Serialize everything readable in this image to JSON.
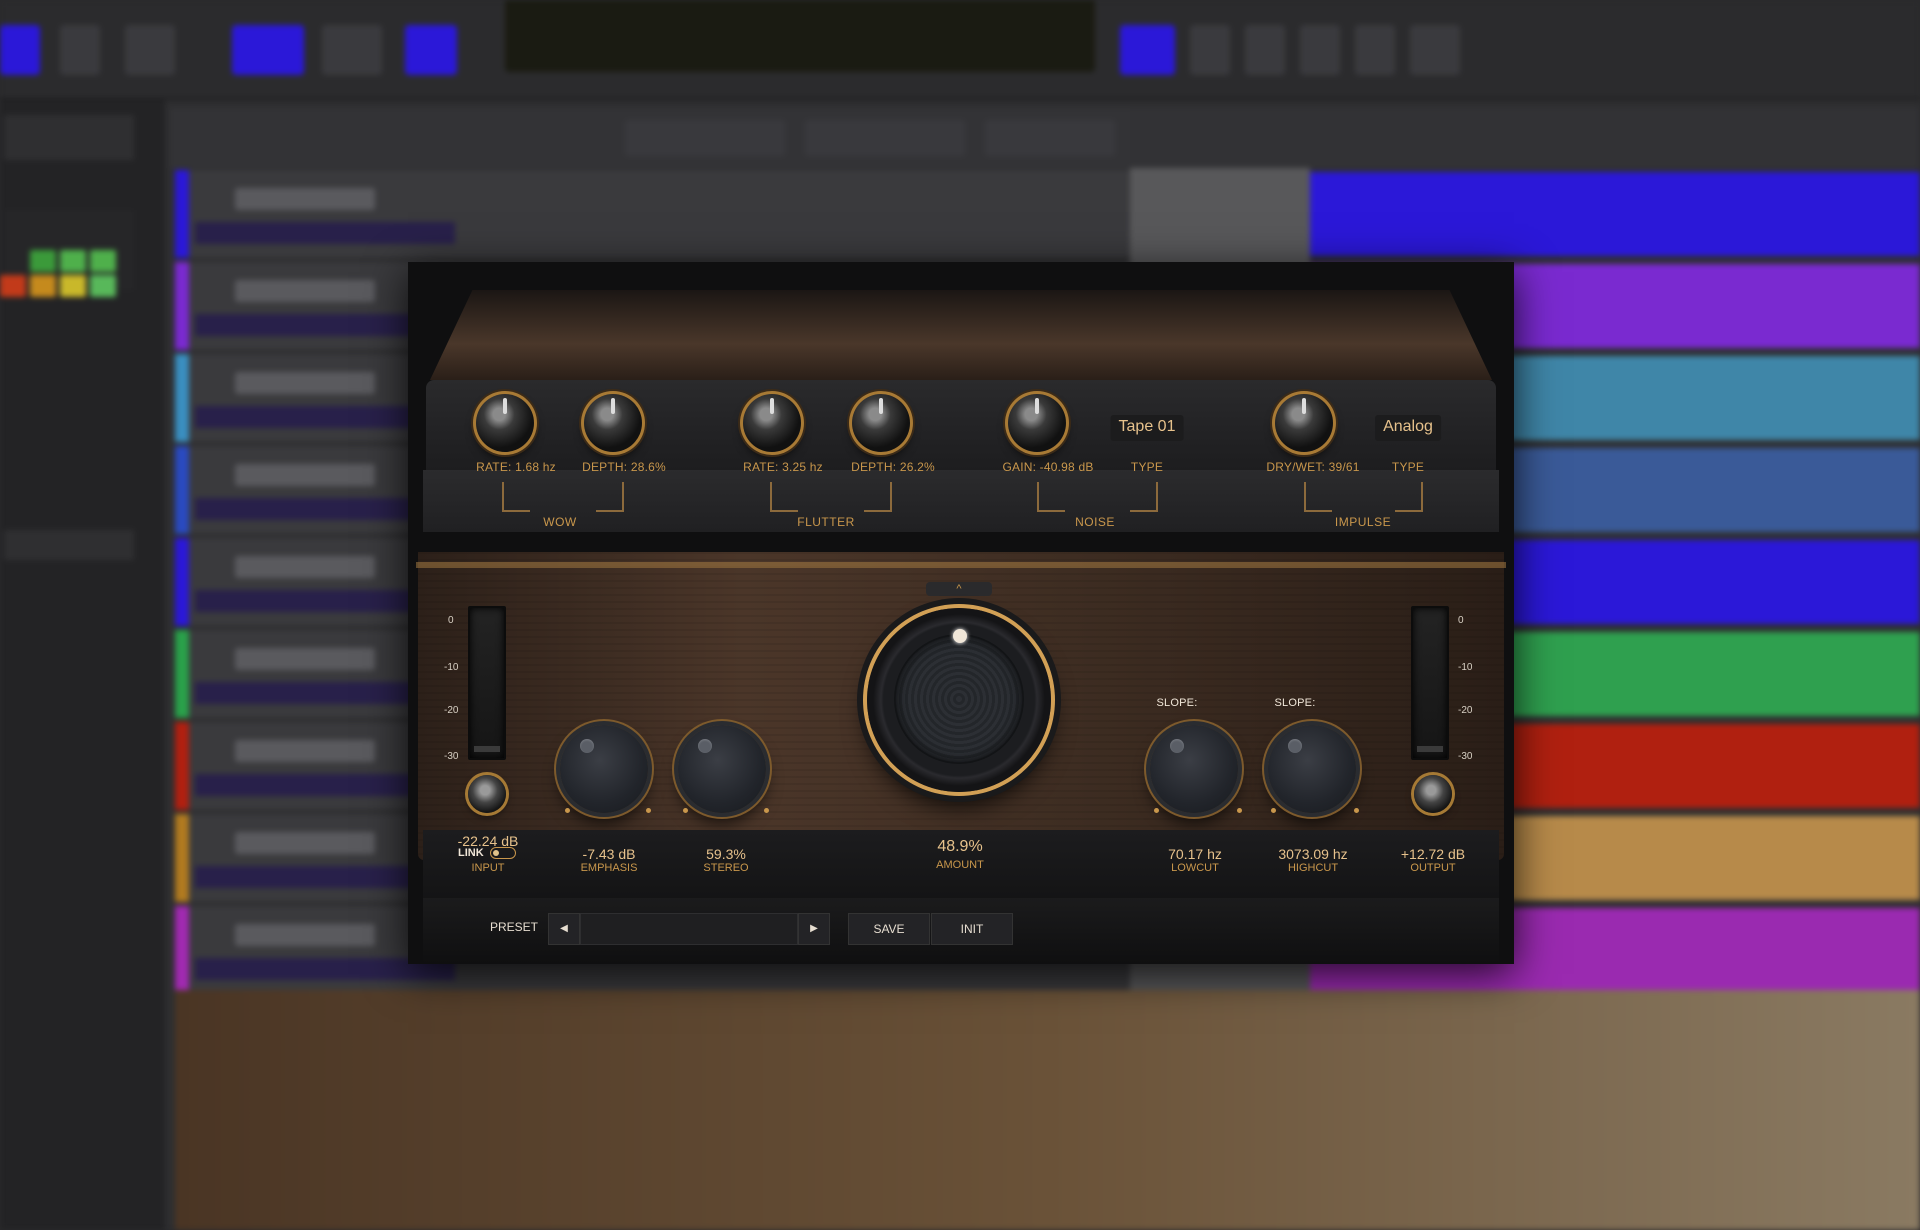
{
  "plugin": {
    "wow": {
      "group_label": "WOW",
      "rate_label": "RATE: 1.68 hz",
      "depth_label": "DEPTH: 28.6%"
    },
    "flutter": {
      "group_label": "FLUTTER",
      "rate_label": "RATE: 3.25 hz",
      "depth_label": "DEPTH: 26.2%"
    },
    "noise": {
      "group_label": "NOISE",
      "gain_label": "GAIN: -40.98 dB",
      "type_label": "TYPE",
      "type_value": "Tape 01"
    },
    "impulse": {
      "group_label": "IMPULSE",
      "drywet_label": "DRY/WET: 39/61",
      "type_label": "TYPE",
      "type_value": "Analog"
    },
    "meter_scale": [
      "0",
      "-10",
      "-20",
      "-30"
    ],
    "slope_label": "SLOPE:",
    "collapse_glyph": "^",
    "input": {
      "value": "-22.24 dB",
      "label": "INPUT",
      "link_label": "LINK"
    },
    "emphasis": {
      "value": "-7.43 dB",
      "label": "EMPHASIS"
    },
    "stereo": {
      "value": "59.3%",
      "label": "STEREO"
    },
    "amount": {
      "value": "48.9%",
      "label": "AMOUNT"
    },
    "lowcut": {
      "value": "70.17 hz",
      "label": "LOWCUT"
    },
    "highcut": {
      "value": "3073.09 hz",
      "label": "HIGHCUT"
    },
    "output": {
      "value": "+12.72 dB",
      "label": "OUTPUT"
    },
    "footer": {
      "preset_label": "PRESET",
      "prev_glyph": "◀",
      "next_glyph": "▶",
      "save_label": "SAVE",
      "init_label": "INIT"
    }
  },
  "colors": {
    "accent_gold": "#c9974c",
    "value_text": "#e7c28c",
    "daw_blue": "#2b18d8"
  }
}
